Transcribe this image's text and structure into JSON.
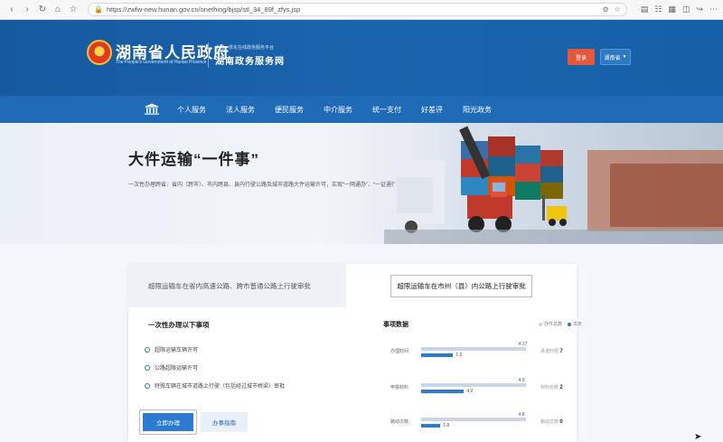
{
  "browser": {
    "url": "https://zwfw-new.hunan.gov.cn/onething/bjsp/stl_34_89f_zfys.jsp"
  },
  "header": {
    "site_title": "湖南省人民政府",
    "site_subtitle": "The People's Government of Hunan Province",
    "portal_small": "全国一体化在线政务服务平台",
    "portal_name": "湖南政务服务网",
    "login_label": "登录",
    "station_label": "湖南省"
  },
  "nav": {
    "items": [
      "个人服务",
      "法人服务",
      "便民服务",
      "中介服务",
      "统一支付",
      "好差评",
      "阳光政务"
    ]
  },
  "banner": {
    "title": "大件运输“一件事”",
    "description": "一次性办理跨省、省内（跨市）、市内跨县、县内行驶公路及城市道路大件运输许可，实现“一网通办”、“一证通行”。"
  },
  "tabs": {
    "left_label": "超限运输车在省内高速公路、跨市普通公路上行驶审批",
    "active_label": "超限运输车在市州（县）内公路上行驶审批"
  },
  "left_panel": {
    "heading": "一次性办理以下事项",
    "items": [
      "超限运输车辆许可",
      "公路超限运输许可",
      "特殊车辆在城市道路上行驶（包括经过城市桥梁）审批"
    ],
    "apply_label": "立即办理",
    "guide_label": "办事指南"
  },
  "right_panel": {
    "heading": "事项数据",
    "legend": [
      {
        "label": "办件总数",
        "color": "#c9d6e6"
      },
      {
        "label": "本年",
        "color": "#2a7bd1"
      }
    ],
    "bars": [
      {
        "label": "办理时间",
        "total_label": "4.17",
        "total_frac": 0.98,
        "year_label": "1.5",
        "year_frac": 0.3,
        "side_text": "承诺时限",
        "side_value": "7"
      },
      {
        "label": "申报材料",
        "total_label": "4.9",
        "total_frac": 0.98,
        "year_label": "4.9",
        "year_frac": 0.4,
        "side_text": "材料份数",
        "side_value": "2"
      },
      {
        "label": "跑动次数",
        "total_label": "4.8",
        "total_frac": 0.98,
        "year_label": "1.8",
        "year_frac": 0.18,
        "side_text": "跑动次数",
        "side_value": "0"
      }
    ]
  }
}
